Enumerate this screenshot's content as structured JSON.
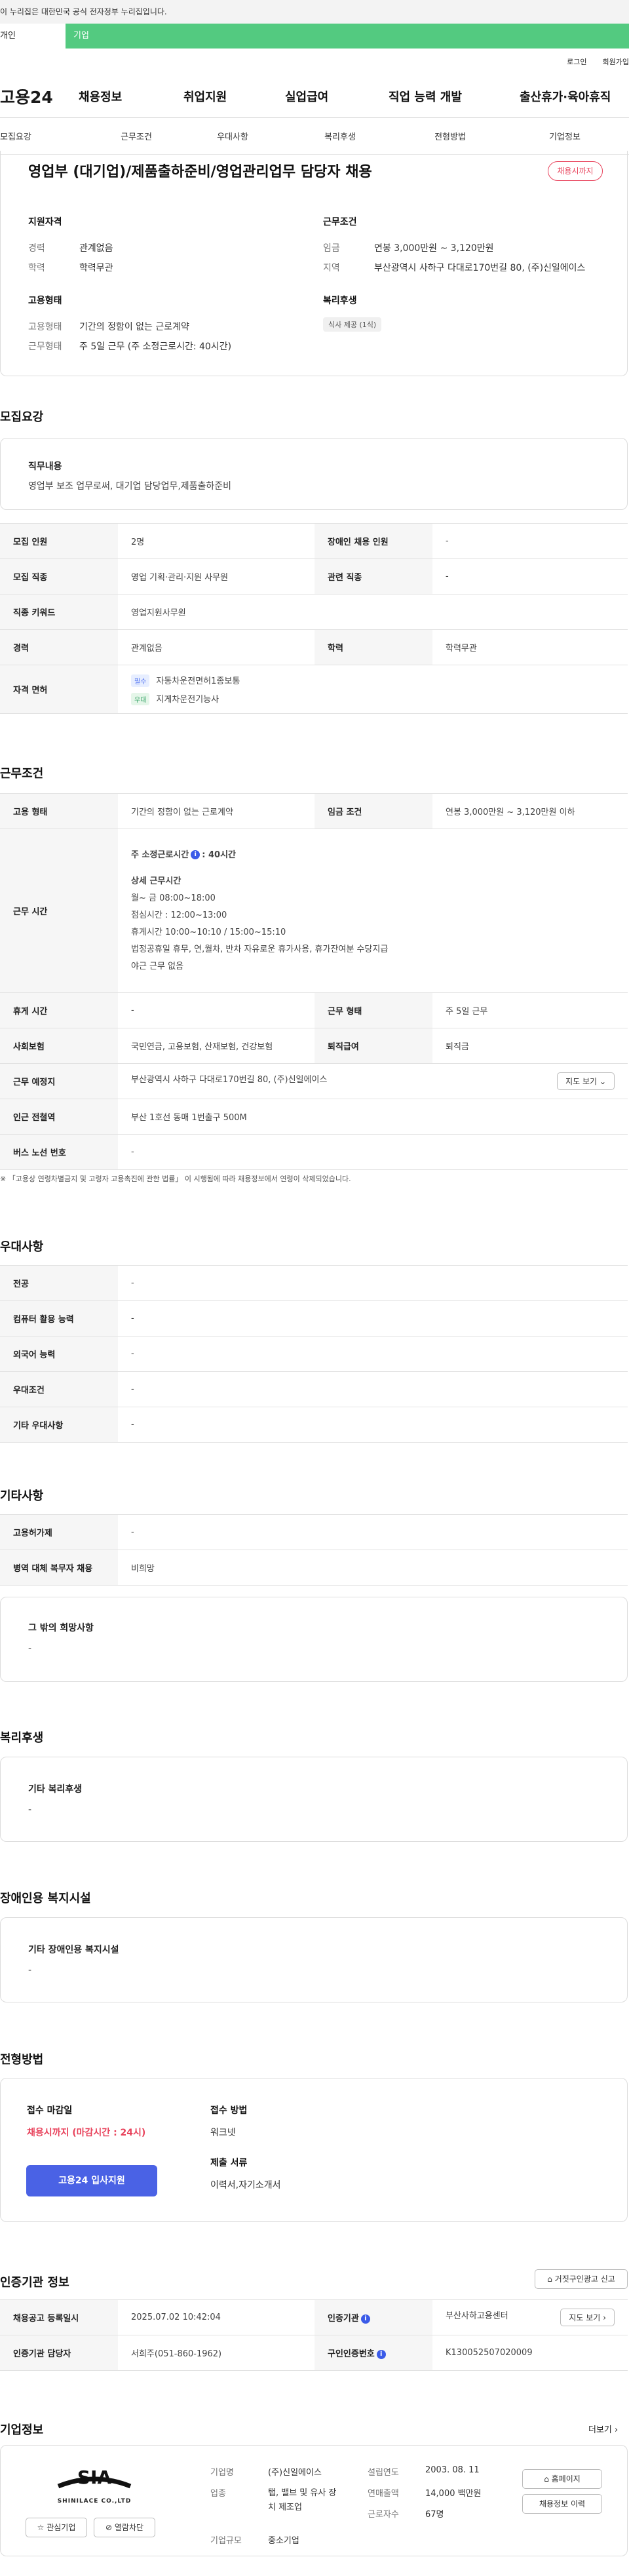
{
  "gov_banner": "이 누리집은 대한민국 공식 전자정부 누리집입니다.",
  "service_tabs": {
    "person": "개인",
    "business": "기업"
  },
  "utility": {
    "login": "로그인",
    "signup": "회원가입"
  },
  "gnb": {
    "logo": "고용24",
    "items": [
      "채용정보",
      "취업지원",
      "실업급여",
      "직업 능력 개발",
      "출산휴가·육아휴직"
    ]
  },
  "job_nav": [
    "모집요강",
    "근무조건",
    "우대사항",
    "복리후생",
    "전형방법",
    "기업정보"
  ],
  "summary": {
    "title": "영업부 (대기업)/제품출하준비/영업관리업무 담당자 채용",
    "badge": "채용시까지",
    "qual": {
      "heading": "지원자격",
      "rows": [
        {
          "k": "경력",
          "v": "관계없음"
        },
        {
          "k": "학력",
          "v": "학력무관"
        }
      ]
    },
    "cond": {
      "heading": "근무조건",
      "rows": [
        {
          "k": "임금",
          "v": "연봉 3,000만원 ~ 3,120만원"
        },
        {
          "k": "지역",
          "v": "부산광역시 사하구 다대로170번길 80, (주)신일에이스"
        }
      ]
    },
    "emp": {
      "heading": "고용형태",
      "rows": [
        {
          "k": "고용형태",
          "v": "기간의 정함이 없는 근로계약"
        },
        {
          "k": "근무형태",
          "v": "주 5일 근무 (주 소정근로시간: 40시간)"
        }
      ]
    },
    "welfare": {
      "heading": "복리후생",
      "chip": "식사 제공 (1식)"
    }
  },
  "recruit": {
    "title": "모집요강",
    "duty_heading": "직무내용",
    "duty_text": "영업부 보조 업무로써, 대기업 담당업무,제품출하준비",
    "rows": [
      {
        "k1": "모집 인원",
        "v1": "2명",
        "k2": "장애인 채용 인원",
        "v2": "-"
      },
      {
        "k1": "모집 직종",
        "v1": "영업 기획·관리·지원 사무원",
        "k2": "관련 직종",
        "v2": "-"
      },
      {
        "k1": "직종 키워드",
        "v1": "영업지원사무원"
      },
      {
        "k1": "경력",
        "v1": "관계없음",
        "k2": "학력",
        "v2": "학력무관"
      }
    ],
    "cert_label": "자격 면허",
    "certs": [
      {
        "tag": "필수",
        "name": "자동차운전면허1종보통"
      },
      {
        "tag": "우대",
        "name": "지게차운전기능사"
      }
    ]
  },
  "work": {
    "title": "근무조건",
    "emp_type_k": "고용 형태",
    "emp_type_v": "기간의 정함이 없는 근로계약",
    "wage_k": "임금 조건",
    "wage_v": "연봉 3,000만원 ~ 3,120만원 이하",
    "hours_k": "근무 시간",
    "hours_week_label": "주 소정근로시간",
    "hours_week_value": ": 40시간",
    "hours_detail_title": "상세 근무시간",
    "hours_lines": [
      "월~ 금 08:00~18:00",
      "점심시간 : 12:00~13:00",
      "휴게시간 10:00~10:10 / 15:00~15:10",
      "법정공휴일 휴무, 연,월차, 반차 자유로운 휴가사용, 휴가잔여분 수당지급",
      "야근 근무 없음"
    ],
    "rest_k": "휴게 시간",
    "rest_v": "-",
    "worktype_k": "근무 형태",
    "worktype_v": "주 5일 근무",
    "insurance_k": "사회보험",
    "insurance_v": "국민연금, 고용보험, 산재보험, 건강보험",
    "severance_k": "퇴직급여",
    "severance_v": "퇴직금",
    "place_k": "근무 예정지",
    "place_v": "부산광역시 사하구 다대로170번길 80, (주)신일에이스",
    "map_btn": "지도 보기",
    "subway_k": "인근 전철역",
    "subway_v": "부산 1호선 동매 1번출구 500M",
    "bus_k": "버스 노선 번호",
    "bus_v": "-",
    "note": "※ 「고용상 연령차별금지 및 고령자 고용촉진에 관한 법률」 이 시행됨에 따라 채용정보에서 연령이 삭제되었습니다."
  },
  "preference": {
    "title": "우대사항",
    "rows": [
      {
        "k": "전공",
        "v": "-"
      },
      {
        "k": "컴퓨터 활용 능력",
        "v": "-"
      },
      {
        "k": "외국어 능력",
        "v": "-"
      },
      {
        "k": "우대조건",
        "v": "-"
      },
      {
        "k": "기타 우대사항",
        "v": "-"
      }
    ]
  },
  "other": {
    "title": "기타사항",
    "rows": [
      {
        "k": "고용허가제",
        "v": "-"
      },
      {
        "k": "병역 대체 복무자 채용",
        "v": "비희망"
      }
    ],
    "wish_heading": "그 밖의 희망사항",
    "wish_text": "-"
  },
  "welfare": {
    "title": "복리후생",
    "heading": "기타 복리후생",
    "text": "-"
  },
  "disability": {
    "title": "장애인용 복지시설",
    "heading": "기타 장애인용 복지시설",
    "text": "-"
  },
  "selection": {
    "title": "전형방법",
    "deadline_label": "접수 마감일",
    "deadline_value": "채용시까지 (마감시간 : 24시)",
    "apply_btn": "고용24 입사지원",
    "method_label": "접수 방법",
    "method_value": "워크넷",
    "docs_label": "제출 서류",
    "docs_value": "이력서,자기소개서"
  },
  "agency": {
    "title": "인증기관 정보",
    "report_btn": "거짓구인광고 신고",
    "rows": [
      {
        "k1": "채용공고 등록일시",
        "v1": "2025.07.02 10:42:04",
        "k2": "인증기관",
        "v2": "부산사하고용센터",
        "btn": "지도 보기"
      },
      {
        "k1": "인증기관 담당자",
        "v1": "서희주(051-860-1962)",
        "k2": "구인인증번호",
        "v2": "K130052507020009"
      }
    ]
  },
  "company": {
    "title": "기업정보",
    "more": "더보기",
    "logo_name": "SHINILACE CO.,LTD",
    "interest_btn": "관심기업",
    "block_btn": "열람차단",
    "fields": [
      {
        "k": "기업명",
        "v": "(주)신일에이스"
      },
      {
        "k": "업종",
        "v": "탭, 밸브 및 유사 장치 제조업"
      },
      {
        "k": "기업규모",
        "v": "중소기업"
      }
    ],
    "fields2": [
      {
        "k": "설립연도",
        "v": "2003. 08. 11"
      },
      {
        "k": "연매출액",
        "v": "14,000 백만원"
      },
      {
        "k": "근로자수",
        "v": "67명"
      }
    ],
    "homepage_btn": "홈페이지",
    "history_btn": "채용정보 이력"
  }
}
